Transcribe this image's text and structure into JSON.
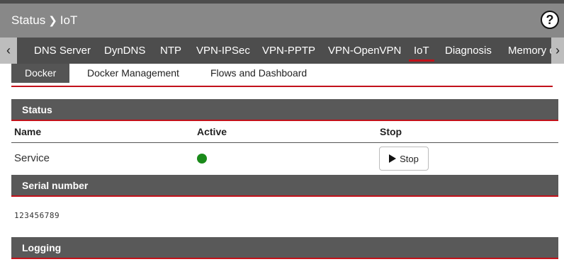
{
  "breadcrumb": {
    "parent": "Status",
    "current": "IoT"
  },
  "help_label": "?",
  "tabs": [
    {
      "label": "DNS Server"
    },
    {
      "label": "DynDNS"
    },
    {
      "label": "NTP"
    },
    {
      "label": "VPN-IPSec"
    },
    {
      "label": "VPN-PPTP"
    },
    {
      "label": "VPN-OpenVPN"
    },
    {
      "label": "IoT",
      "active": true
    },
    {
      "label": "Diagnosis"
    },
    {
      "label": "Memory d"
    }
  ],
  "subtabs": [
    {
      "label": "Docker",
      "active": true
    },
    {
      "label": "Docker Management"
    },
    {
      "label": "Flows and Dashboard"
    }
  ],
  "status_section": {
    "title": "Status",
    "columns": [
      "Name",
      "Active",
      "Stop"
    ],
    "row": {
      "name": "Service",
      "active": true,
      "stop_label": "Stop"
    }
  },
  "serial_section": {
    "title": "Serial number",
    "value": "123456789"
  },
  "logging_section": {
    "title": "Logging"
  },
  "colors": {
    "accent": "#c2111a",
    "header": "#888888",
    "tabbar": "#4d4d4d",
    "active_dot": "#1a8a1a"
  }
}
